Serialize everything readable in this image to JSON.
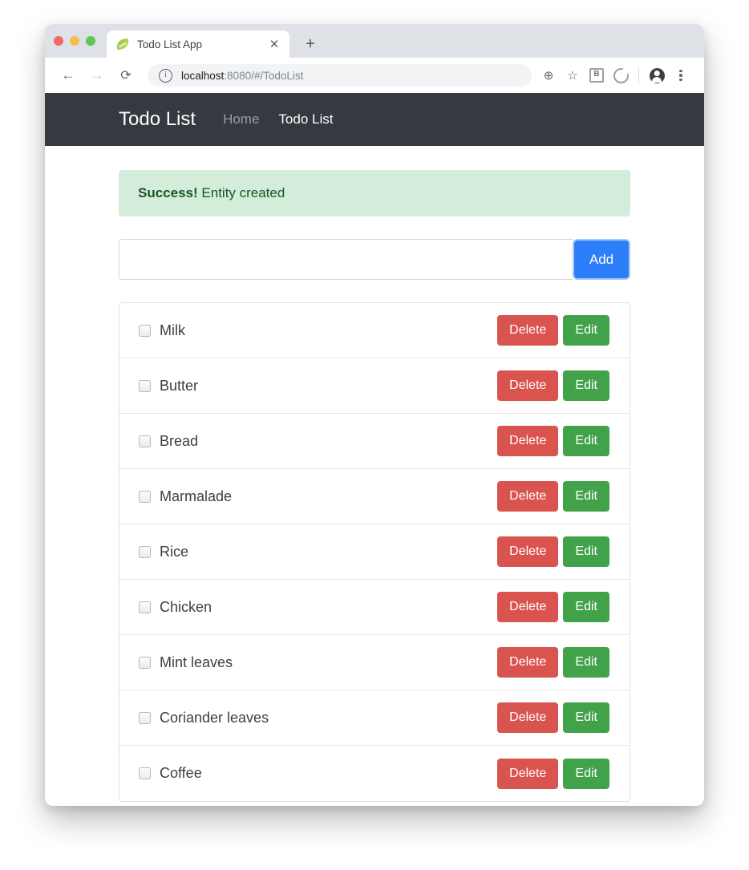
{
  "browser": {
    "tab": {
      "title": "Todo List App",
      "favicon": "spring-leaf-icon",
      "close_label": "✕"
    },
    "new_tab_label": "+",
    "nav": {
      "back": "←",
      "forward": "→",
      "reload": "⟳"
    },
    "omnibox": {
      "info_label": "i",
      "url_host": "localhost",
      "url_rest": ":8080/#/TodoList"
    },
    "toolbar_icons": {
      "zoom": "⊕",
      "bookmark": "☆",
      "extension_b": "B",
      "extension_circle": "circle-extension-icon",
      "profile": "profile-avatar-icon",
      "menu": "kebab-menu-icon"
    }
  },
  "navbar": {
    "brand": "Todo List",
    "links": [
      {
        "label": "Home",
        "active": false
      },
      {
        "label": "Todo List",
        "active": true
      }
    ]
  },
  "alert": {
    "strong": "Success!",
    "message": " Entity created",
    "color": "#d4edda",
    "text_color": "#155724"
  },
  "form": {
    "input_value": "",
    "input_placeholder": "",
    "add_label": "Add",
    "add_color": "#2d7ff9"
  },
  "buttons": {
    "delete_label": "Delete",
    "edit_label": "Edit",
    "delete_color": "#d9534f",
    "edit_color": "#42a24a"
  },
  "todos": [
    {
      "label": "Milk",
      "checked": false
    },
    {
      "label": "Butter",
      "checked": false
    },
    {
      "label": "Bread",
      "checked": false
    },
    {
      "label": "Marmalade",
      "checked": false
    },
    {
      "label": "Rice",
      "checked": false
    },
    {
      "label": "Chicken",
      "checked": false
    },
    {
      "label": "Mint leaves",
      "checked": false
    },
    {
      "label": "Coriander leaves",
      "checked": false
    },
    {
      "label": "Coffee",
      "checked": false
    }
  ]
}
